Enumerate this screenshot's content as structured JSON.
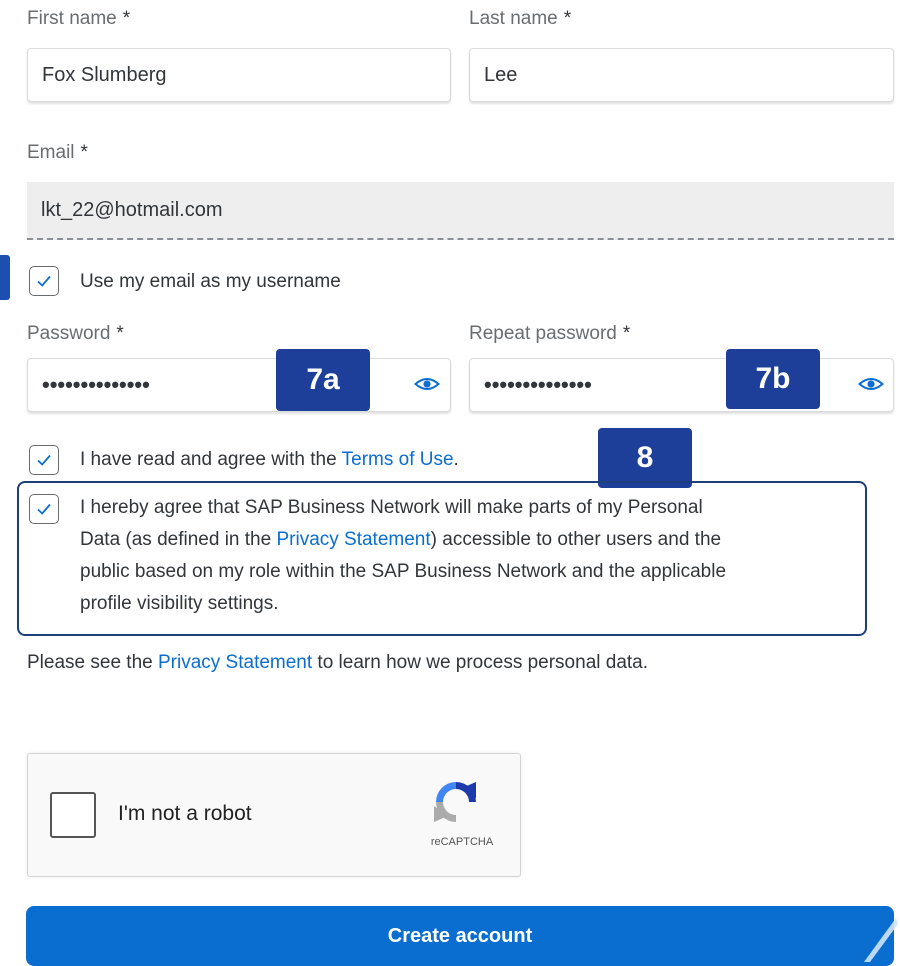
{
  "form": {
    "first_name": {
      "label": "First name",
      "required": "*",
      "value": "Fox Slumberg"
    },
    "last_name": {
      "label": "Last name",
      "required": "*",
      "value": "Lee"
    },
    "email": {
      "label": "Email",
      "required": "*",
      "value": "lkt_22@hotmail.com"
    },
    "use_email_username": {
      "label": "Use my email as my username",
      "checked": true
    },
    "password": {
      "label": "Password",
      "required": "*",
      "value": "••••••••••••••"
    },
    "repeat_password": {
      "label": "Repeat password",
      "required": "*",
      "value": "••••••••••••••"
    },
    "terms": {
      "prefix": "I have read and agree with the ",
      "link": "Terms of Use",
      "suffix": ".",
      "checked": true
    },
    "personal_data": {
      "line1": "I hereby agree that SAP Business Network will make parts of my Personal",
      "line2_prefix": "Data (as defined in the ",
      "line2_link": "Privacy Statement",
      "line2_suffix": ") accessible to other users and the",
      "line3": "public based on my role within the SAP Business Network and the applicable",
      "line4": "profile visibility settings.",
      "checked": true
    },
    "privacy_note": {
      "prefix": "Please see the ",
      "link": "Privacy Statement",
      "suffix": " to learn how we process personal data."
    },
    "captcha": {
      "label": "I'm not a robot",
      "brand": "reCAPTCHA"
    },
    "submit_label": "Create account"
  },
  "annotations": {
    "badge_7a": "7a",
    "badge_7b": "7b",
    "badge_8": "8"
  },
  "colors": {
    "link": "#0a6ed1",
    "primary": "#0a6ed1",
    "badge": "#1d3f9a",
    "highlight_border": "#1d3f7a"
  },
  "icons": {
    "password_toggle": "eye-icon",
    "checkbox": "checkmark-icon",
    "captcha_logo": "recaptcha-logo"
  }
}
